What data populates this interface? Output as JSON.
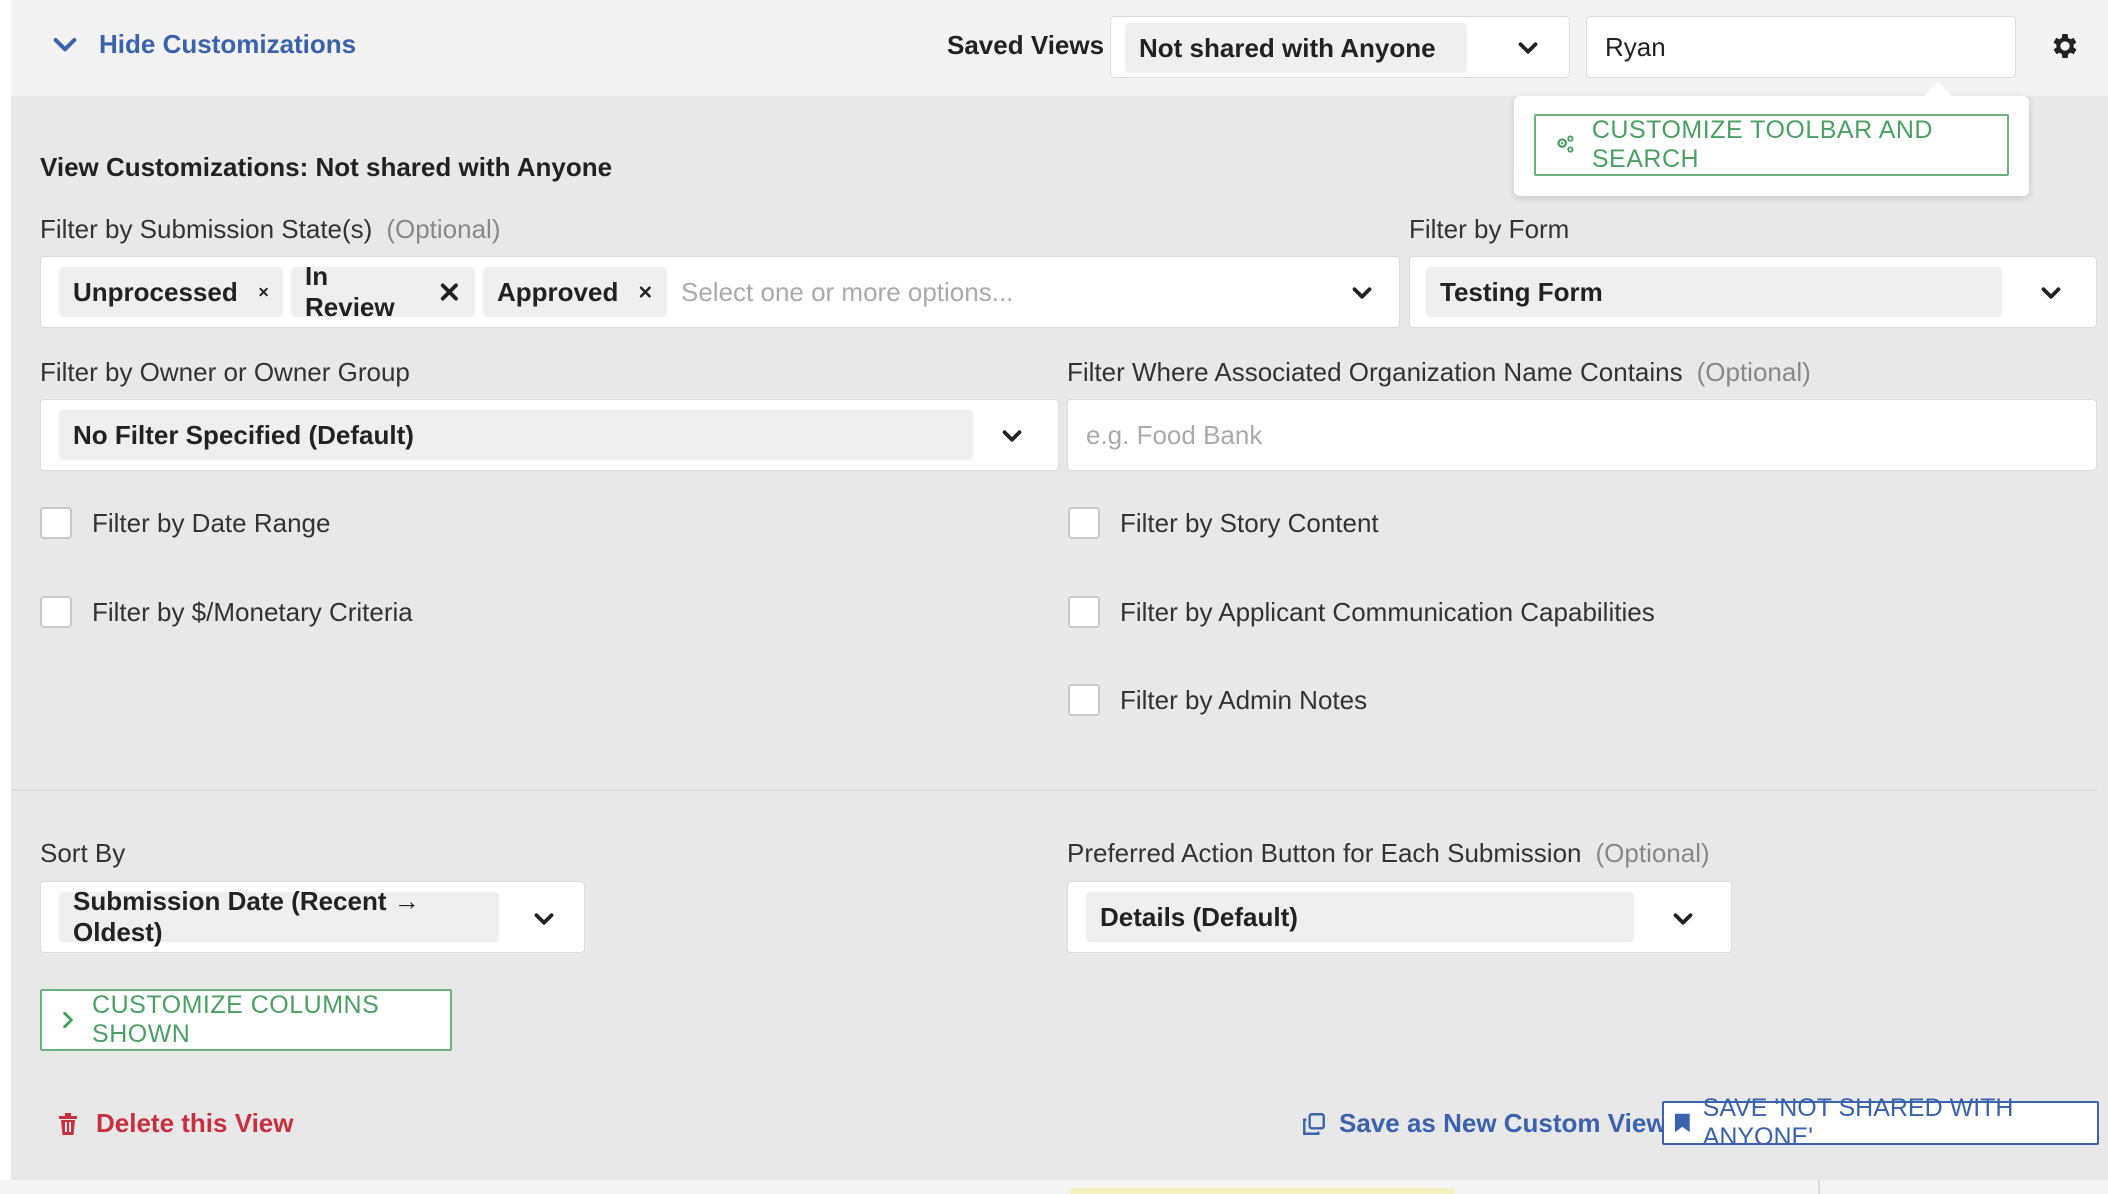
{
  "topbar": {
    "hide_label": "Hide Customizations",
    "saved_views_label": "Saved Views",
    "saved_view_selected": "Not shared with Anyone",
    "search_value": "Ryan"
  },
  "popover": {
    "customize_toolbar_label": "CUSTOMIZE TOOLBAR AND SEARCH"
  },
  "main": {
    "section_title": "View Customizations: Not shared with Anyone",
    "submission_state": {
      "label": "Filter by Submission State(s)",
      "optional": "(Optional)",
      "tags": [
        "Unprocessed",
        "In Review",
        "Approved"
      ],
      "placeholder": "Select one or more options..."
    },
    "form_filter": {
      "label": "Filter by Form",
      "selected": "Testing Form"
    },
    "owner_filter": {
      "label": "Filter by Owner or Owner Group",
      "selected": "No Filter Specified (Default)"
    },
    "org_filter": {
      "label": "Filter Where Associated Organization Name Contains",
      "optional": "(Optional)",
      "placeholder": "e.g. Food Bank"
    },
    "checkboxes_left": [
      "Filter by Date Range",
      "Filter by $/Monetary Criteria"
    ],
    "checkboxes_right": [
      "Filter by Story Content",
      "Filter by Applicant Communication Capabilities",
      "Filter by Admin Notes"
    ],
    "sort_by": {
      "label": "Sort By",
      "selected": "Submission Date (Recent → Oldest)"
    },
    "preferred_action": {
      "label": "Preferred Action Button for Each Submission",
      "optional": "(Optional)",
      "selected": "Details (Default)"
    },
    "customize_columns_label": "CUSTOMIZE COLUMNS SHOWN"
  },
  "footer": {
    "delete_label": "Delete this View",
    "save_new_label": "Save as New Custom View",
    "save_label": "SAVE 'NOT SHARED WITH ANYONE'"
  },
  "colors": {
    "link_blue": "#3a62ad",
    "green": "#4aa163",
    "danger_red": "#c8303f"
  }
}
